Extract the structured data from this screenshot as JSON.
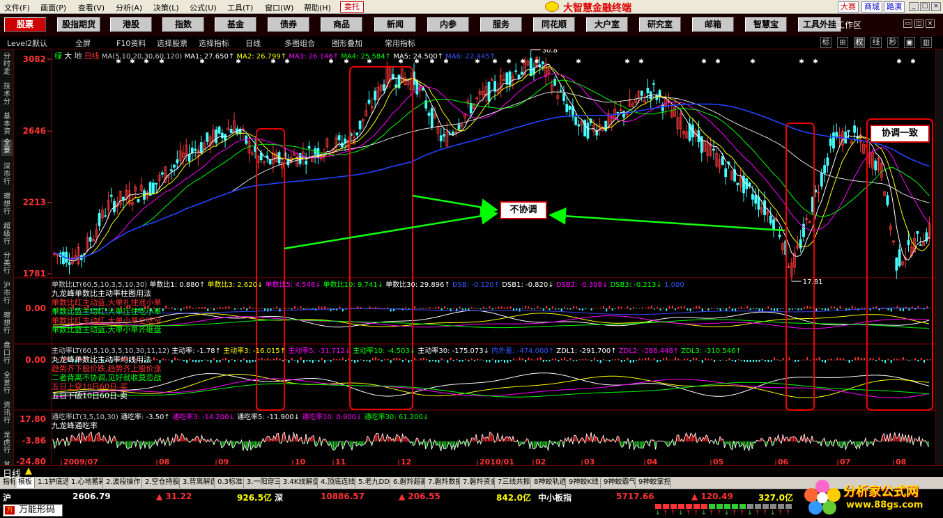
{
  "menu": [
    "文件(F)",
    "画面(P)",
    "查看(V)",
    "分析(A)",
    "决策(L)",
    "公式(U)",
    "工具(T)",
    "窗口(W)",
    "帮助(H)"
  ],
  "weituo": "委托",
  "app_title": "大智慧金融终端",
  "right_links": [
    "大赛",
    "商城",
    "路演"
  ],
  "toolbar": [
    "股票",
    "股指期货",
    "港股",
    "指数",
    "基金",
    "债券",
    "商品",
    "新闻",
    "内参",
    "服务",
    "同花顺",
    "大户室",
    "研究室",
    "邮箱",
    "智慧宝",
    "工具外挂"
  ],
  "workarea": "工作区",
  "subbar": [
    "Level2默认",
    "全屏",
    "F10资料",
    "选择股票",
    "选择指标",
    "日线",
    "多图组合",
    "图形叠加",
    "常用指标"
  ],
  "subbar_right": [
    "标",
    "⊞",
    "权",
    "线",
    "秒",
    "▣",
    "▥"
  ],
  "left_tabs": [
    "分时走势",
    "技术分析",
    "基本资料",
    "全景",
    "深市行情",
    "理想行情",
    "超级行情",
    "分类行情",
    "沪市行情",
    "理想行情",
    "盘口行情",
    "全景行情",
    "资讯行情",
    "龙虎行情",
    "其他"
  ],
  "main_header": {
    "green_label": "绿",
    "big_label": "大",
    "di_label": "地",
    "period": "日线",
    "ma_params": "MA(5,10,20,30,60,120)",
    "ma": [
      {
        "text": "MA1: 27.650↑",
        "color": "#ffffff"
      },
      {
        "text": "MA2: 26.799↑",
        "color": "#ffff00"
      },
      {
        "text": "MA3: 26.146↑",
        "color": "#ff00ff"
      },
      {
        "text": "MA4: 25.584↑",
        "color": "#00ff00"
      },
      {
        "text": "MA5: 24.500↑",
        "color": "#ffffff"
      },
      {
        "text": "MA6: 22.445↑",
        "color": "#3355ff"
      }
    ]
  },
  "price_axis": [
    "3082",
    "2646",
    "2213",
    "1781"
  ],
  "high_label": "30.8",
  "low_label": "17.81",
  "panel1": {
    "title": "单数比LT(60,5,10,3,5,10,30)",
    "values": [
      {
        "text": "单数比1: 0.880↑",
        "color": "#ffffff"
      },
      {
        "text": "单数比3: 2.620↓",
        "color": "#ffff00"
      },
      {
        "text": "单数比5: 4.548↓",
        "color": "#ff00ff"
      },
      {
        "text": "单数比10: 9.741↓",
        "color": "#00ff00"
      },
      {
        "text": "单数比30: 29.896↑",
        "color": "#ffffff"
      },
      {
        "text": "DSB: -0.120↑",
        "color": "#3355ff"
      },
      {
        "text": "DSB1: -0.820↓",
        "color": "#ffffff"
      },
      {
        "text": "DSB2: -0.308↓",
        "color": "#ff00ff"
      },
      {
        "text": "DSB3: -0.213↓",
        "color": "#00ff00"
      },
      {
        "text": "1.000",
        "color": "#3355ff"
      }
    ],
    "axis": "0.00",
    "notes": [
      {
        "text": "九龙峰单数比主动率柱图用法",
        "color": "#ffffff"
      },
      {
        "text": "单数比红主动蓝,大单扎住涨小单",
        "color": "#ff3333"
      },
      {
        "text": "单数比蓝主动红,大单压住吃小单",
        "color": "#00ff00"
      },
      {
        "text": "单数比红主动红,大单小单全吃空",
        "color": "#ff3333"
      },
      {
        "text": "单数比蓝主动蓝,大单小单齐砸盘",
        "color": "#00ff00"
      }
    ]
  },
  "panel2": {
    "title": "主动率LT(60,5,10,3,5,10,30,11,12)",
    "values": [
      {
        "text": "主动率: -1.78↑",
        "color": "#ffffff"
      },
      {
        "text": "主动率3: -16.015↑",
        "color": "#ffff00"
      },
      {
        "text": "主动率5: -31.712↓",
        "color": "#ff00ff"
      },
      {
        "text": "主动率10: -4.503↓",
        "color": "#00ff00"
      },
      {
        "text": "主动率30: -175.073↓",
        "color": "#ffffff"
      },
      {
        "text": "内外差: -474.000↑",
        "color": "#3355ff"
      },
      {
        "text": "ZDL1: -291.700↑",
        "color": "#ffffff"
      },
      {
        "text": "ZDL2: -286.448↑",
        "color": "#ff00ff"
      },
      {
        "text": "ZDL3: -310.546↑",
        "color": "#00ff00"
      }
    ],
    "axis": "0.00",
    "notes": [
      {
        "text": "九龙峰单数比主动率均线用法",
        "color": "#ffffff"
      },
      {
        "text": "趋势齐下股价跌,趋势齐上股价涨",
        "color": "#ff3333"
      },
      {
        "text": "二者背离不协调,见好就收莫恋战",
        "color": "#00ff00"
      },
      {
        "text": "五日上穿10日60日-买",
        "color": "#ff3333"
      },
      {
        "text": "五日下破10日60日-卖",
        "color": "#ffffff"
      }
    ]
  },
  "panel3": {
    "title": "通吃率LT(3,5,10,30)",
    "values": [
      {
        "text": "通吃率: -3.50↑",
        "color": "#ffffff"
      },
      {
        "text": "通吃率3: -14.200↓",
        "color": "#ff00ff"
      },
      {
        "text": "通吃率5: -11.900↓",
        "color": "#ffffff"
      },
      {
        "text": "通吃率10: 0.900↓",
        "color": "#ff00ff"
      },
      {
        "text": "通吃率30: 61.200↓",
        "color": "#00ff00"
      }
    ],
    "axis": [
      "17.80",
      "-3.86",
      "-24.80"
    ],
    "notes": [
      {
        "text": "九龙峰通吃率",
        "color": "#ffffff"
      }
    ]
  },
  "callouts": {
    "mid": "不协调",
    "right": "协调一致"
  },
  "x_axis": [
    "2009/07",
    "08",
    "09",
    "10",
    "11",
    "12",
    "2010/01",
    "02",
    "03",
    "04",
    "05",
    "06",
    "07",
    "08"
  ],
  "period_label": "日线",
  "indicator_tabs": [
    "指标",
    "模板",
    "1.1护底选顶",
    "1.心地蓄彩",
    "2.波段操作",
    "2.空仓持股",
    "3.背离解盘",
    "0.3标准",
    "3.一阳穿三",
    "3.4K线解盘",
    "4.顶底连线",
    "5.老九DDE",
    "6.磐羚超赢",
    "7.磐羚数据",
    "7.磐羚资金",
    "7三线共振",
    "8神蛟轨迹",
    "9神蛟K线",
    "9神蛟霸气",
    "9神蛟掌控"
  ],
  "statusbar": [
    {
      "text": "沪",
      "color": "#ffffff"
    },
    {
      "text": "2606.79",
      "color": "#ffffff"
    },
    {
      "text": "▲ 31.22",
      "color": "#ff3333"
    },
    {
      "text": "926.5亿",
      "color": "#ffff00"
    },
    {
      "text": "深",
      "color": "#ffffff"
    },
    {
      "text": "10886.57",
      "color": "#ff3333"
    },
    {
      "text": "▲ 206.55",
      "color": "#ff3333"
    },
    {
      "text": "842.0亿",
      "color": "#ffff00"
    },
    {
      "text": "中小板指",
      "color": "#ffffff"
    },
    {
      "text": "5717.66",
      "color": "#ff3333"
    },
    {
      "text": "▲ 120.49",
      "color": "#ff3333"
    },
    {
      "text": "327.0亿",
      "color": "#ffff00"
    }
  ],
  "input_label": "万能形码",
  "watermark": {
    "line1": "分析家公式网",
    "line2": "www.88gs.com"
  }
}
